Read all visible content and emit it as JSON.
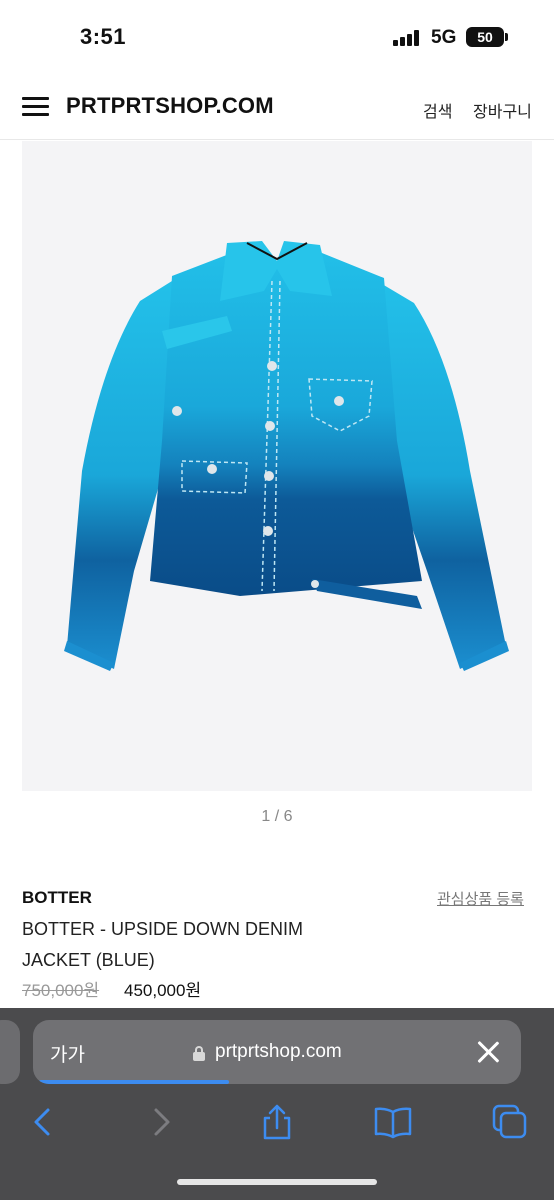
{
  "status_bar": {
    "time": "3:51",
    "network": "5G",
    "battery": "50"
  },
  "header": {
    "site_title": "PRTPRTSHOP.COM",
    "search_label": "검색",
    "cart_label": "장바구니"
  },
  "product": {
    "image_alt": "BOTTER upside down denim jacket in blue gradient",
    "pager": "1 / 6",
    "brand": "BOTTER",
    "wishlist_label": "관심상품 등록",
    "name": "BOTTER - UPSIDE DOWN DENIM JACKET (BLUE)",
    "original_price": "750,000원",
    "sale_price": "450,000원"
  },
  "browser": {
    "text_size_label": "가가",
    "url": "prtprtshop.com",
    "load_progress": 0.39,
    "accent_color": "#3d8cf0",
    "toolbar": [
      "back-icon",
      "forward-icon",
      "share-icon",
      "bookmarks-icon",
      "tabs-icon"
    ]
  },
  "colors": {
    "jacket_light": "#1fb8e4",
    "jacket_dark": "#0a4f8e",
    "image_background": "#f4f4f6",
    "browser_bar": "#4b4b4d"
  }
}
